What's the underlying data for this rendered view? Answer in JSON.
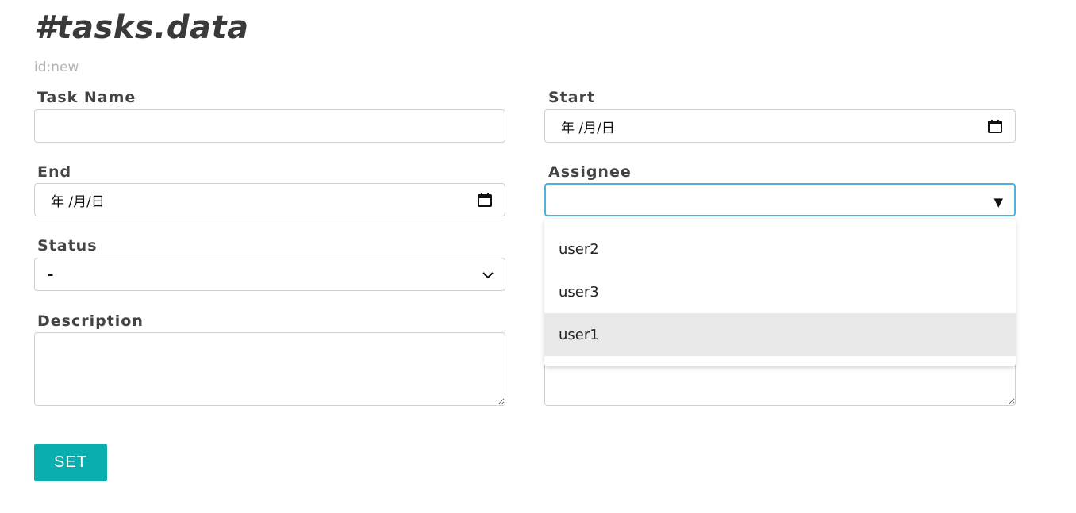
{
  "header": {
    "title": "#tasks.data",
    "record_id": "id:new"
  },
  "form": {
    "task_name": {
      "label": "Task Name",
      "value": ""
    },
    "start": {
      "label": "Start",
      "value": "年 /月/日"
    },
    "end": {
      "label": "End",
      "value": "年 /月/日"
    },
    "assignee": {
      "label": "Assignee",
      "value": "",
      "options": [
        "user2",
        "user3",
        "user1"
      ],
      "highlighted": "user1"
    },
    "status": {
      "label": "Status",
      "value": "-"
    },
    "description": {
      "label": "Description",
      "value": ""
    }
  },
  "actions": {
    "set_label": "SET"
  },
  "colors": {
    "accent": "#0aaeae",
    "focus_border": "#4cb2e0",
    "label": "#444444",
    "muted": "#b4b4b4"
  },
  "icons": [
    "calendar-icon",
    "chevron-down-icon",
    "triangle-down-icon",
    "resize-handle-icon"
  ]
}
